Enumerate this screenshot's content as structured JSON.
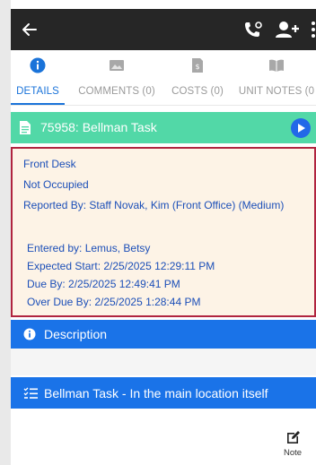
{
  "appbar": {
    "back_icon": "arrow-left-icon",
    "call_icon": "phone-icon",
    "add_user_icon": "add-user-icon",
    "more_icon": "more-vertical-icon"
  },
  "tabs": [
    {
      "label": "DETAILS",
      "icon": "info-icon",
      "active": true
    },
    {
      "label": "COMMENTS (0)",
      "icon": "image-icon",
      "active": false
    },
    {
      "label": "COSTS (0)",
      "icon": "bill-icon",
      "active": false
    },
    {
      "label": "UNIT NOTES (0",
      "icon": "book-icon",
      "active": false
    }
  ],
  "task": {
    "title": "75958: Bellman Task",
    "header_color": "#52d8a7"
  },
  "details": {
    "location": "Front Desk",
    "occupancy": "Not Occupied",
    "reported_by": "Reported By: Staff Novak, Kim (Front Office) (Medium)",
    "entered_by": "Entered by: Lemus, Betsy",
    "expected_start": "Expected Start: 2/25/2025 12:29:11 PM",
    "due_by": "Due By: 2/25/2025 12:49:41 PM",
    "over_due_by": "Over Due By: 2/25/2025 1:28:44 PM"
  },
  "description": {
    "label": "Description"
  },
  "bellman": {
    "label": "Bellman Task - In the main location itself"
  },
  "note": {
    "label": "Note"
  },
  "colors": {
    "accent": "#1a73e8",
    "task_header": "#52d8a7",
    "detail_border": "#b0243f",
    "detail_bg": "#fdf3e6"
  }
}
